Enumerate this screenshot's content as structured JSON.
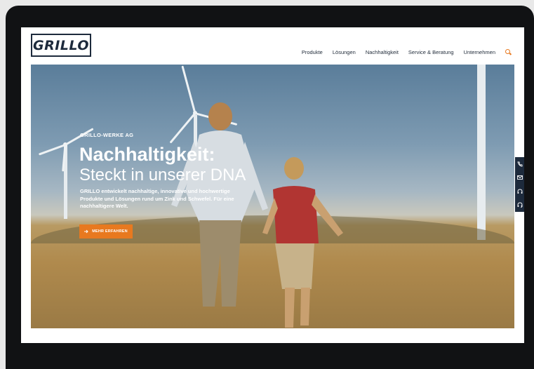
{
  "brand": {
    "logo_text": "GRILLO"
  },
  "nav": {
    "items": [
      "Produkte",
      "Lösungen",
      "Nachhaltigkeit",
      "Service & Beratung",
      "Unternehmen"
    ],
    "search_icon": "search-icon"
  },
  "hero": {
    "eyebrow": "GRILLO-WERKE AG",
    "title": "Nachhaltigkeit:",
    "subtitle": "Steckt in unserer DNA",
    "lead": "GRILLO entwickelt nachhaltige, innovative und hochwertige Produkte und Lösungen rund um Zink und Schwefel. Für eine nachhaltigere Welt.",
    "cta_label": "MEHR ERFAHREN",
    "cta_icon": "arrow-right-icon"
  },
  "side_tabs": [
    "phone-icon",
    "mail-icon",
    "headset-icon",
    "support-icon"
  ],
  "colors": {
    "accent": "#e8791f",
    "navy": "#1d2a3c"
  }
}
